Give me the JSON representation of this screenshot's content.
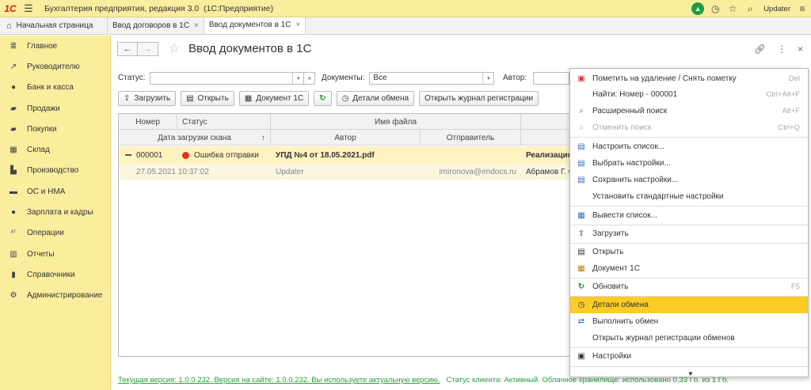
{
  "app": {
    "logo": "1С",
    "title": "Бухгалтерия предприятия, редакция 3.0",
    "mode": "(1С:Предприятие)",
    "user": "Updater"
  },
  "tabs": [
    {
      "label": "Начальная страница"
    },
    {
      "label": "Ввод договоров в 1С"
    },
    {
      "label": "Ввод документов в 1С"
    }
  ],
  "sidebar": {
    "items": [
      {
        "label": "Главное",
        "icon": "list-icon"
      },
      {
        "label": "Руководителю",
        "icon": "trend-icon"
      },
      {
        "label": "Банк и касса",
        "icon": "coin-icon"
      },
      {
        "label": "Продажи",
        "icon": "cart-icon"
      },
      {
        "label": "Покупки",
        "icon": "basket-icon"
      },
      {
        "label": "Склад",
        "icon": "grid-icon"
      },
      {
        "label": "Производство",
        "icon": "factory-icon"
      },
      {
        "label": "ОС и НМА",
        "icon": "truck-icon"
      },
      {
        "label": "Зарплата и кадры",
        "icon": "person-icon"
      },
      {
        "label": "Операции",
        "icon": "operations-icon"
      },
      {
        "label": "Отчеты",
        "icon": "chart-icon"
      },
      {
        "label": "Справочники",
        "icon": "book-icon"
      },
      {
        "label": "Администрирование",
        "icon": "gear-icon"
      }
    ]
  },
  "form": {
    "title": "Ввод документов в 1С",
    "filters": {
      "status_label": "Статус:",
      "status_value": "",
      "documents_label": "Документы:",
      "documents_value": "Все",
      "author_label": "Автор:",
      "author_value": ""
    },
    "toolbar": {
      "load": "Загрузить",
      "open": "Открыть",
      "document1c": "Документ 1С",
      "details": "Детали обмена",
      "journal": "Открыть журнал регистрации"
    },
    "table": {
      "headers1": {
        "number": "Номер",
        "status": "Статус",
        "filename": "Имя файла"
      },
      "headers2": {
        "scan_date": "Дата загрузки скана",
        "author": "Автор",
        "sender": "Отправитель"
      },
      "row1": {
        "number": "000001",
        "status": "Ошибка отправки",
        "filename": "УПД №4 от 18.05.2021.pdf",
        "extra": "Реализация"
      },
      "row2": {
        "date": "27.05.2021 10:37:02",
        "author": "Updater",
        "sender": "imironova@endocs.ru",
        "extra": "Абрамов Г. С"
      }
    },
    "footer": {
      "version": "Текущая версия: 1.0.0.232. Версия на сайте: 1.0.0.232. Вы используете актуальную версию.",
      "status": "Статус клиента: Активный. Облачное хранилище: использовано 0,33 Гб. из 1 Гб."
    }
  },
  "menu": {
    "items": [
      {
        "label": "Пометить на удаление / Снять пометку",
        "shortcut": "Del",
        "icon": "delete-mark-icon"
      },
      {
        "label": "Найти: Номер - 000001",
        "shortcut": "Ctrl+Alt+F",
        "icon": ""
      },
      {
        "label": "Расширенный поиск",
        "shortcut": "Alt+F",
        "icon": "search-icon"
      },
      {
        "label": "Отменить поиск",
        "shortcut": "Ctrl+Q",
        "icon": "cancel-search-icon"
      },
      {
        "label": "Настроить список...",
        "shortcut": "",
        "icon": "list-settings-icon"
      },
      {
        "label": "Выбрать настройки...",
        "shortcut": "",
        "icon": "choose-settings-icon"
      },
      {
        "label": "Сохранить настройки...",
        "shortcut": "",
        "icon": "save-settings-icon"
      },
      {
        "label": "Установить стандартные настройки",
        "shortcut": "",
        "icon": ""
      },
      {
        "label": "Вывести список...",
        "shortcut": "",
        "icon": "print-list-icon"
      },
      {
        "label": "Загрузить",
        "shortcut": "",
        "icon": "upload-icon"
      },
      {
        "label": "Открыть",
        "shortcut": "",
        "icon": "open-icon"
      },
      {
        "label": "Документ 1С",
        "shortcut": "",
        "icon": "document-icon"
      },
      {
        "label": "Обновить",
        "shortcut": "F5",
        "icon": "refresh-icon"
      },
      {
        "label": "Детали обмена",
        "shortcut": "",
        "icon": "history-icon"
      },
      {
        "label": "Выполнить обмен",
        "shortcut": "",
        "icon": "exchange-icon"
      },
      {
        "label": "Открыть журнал регистрации обменов",
        "shortcut": "",
        "icon": ""
      },
      {
        "label": "Настройки",
        "shortcut": "",
        "icon": "settings-icon"
      }
    ]
  },
  "colors": {
    "accent": "#fbcb26",
    "sidebar": "#fbed9e",
    "error": "#e0311a",
    "footer": "#2a9d3b"
  }
}
